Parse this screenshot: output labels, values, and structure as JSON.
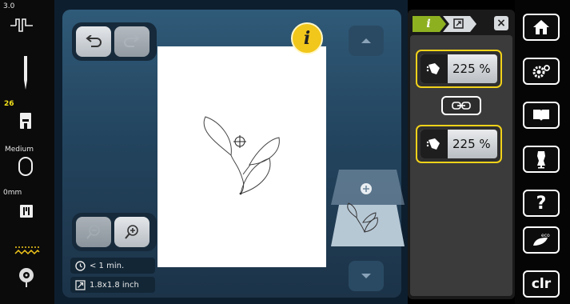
{
  "left_bar": {
    "stitch_width": "3.0",
    "presser_foot_number": "26",
    "presser_pressure": "Medium",
    "needle_position": "0mm"
  },
  "workspace": {
    "info_label": "i",
    "time_estimate": "< 1 min.",
    "design_size": "1.8x1.8 inch"
  },
  "panel": {
    "tab_info": "i",
    "close_label": "×",
    "scale_horizontal": "225 %",
    "scale_vertical": "225 %"
  },
  "right_nav": {
    "clr_label": "clr",
    "help_label": "?",
    "eco_label": "eco"
  },
  "colors": {
    "accent_yellow": "#f2d21a",
    "workspace_blue": "#2f5a78",
    "panel_gray": "#3b3b3b"
  }
}
